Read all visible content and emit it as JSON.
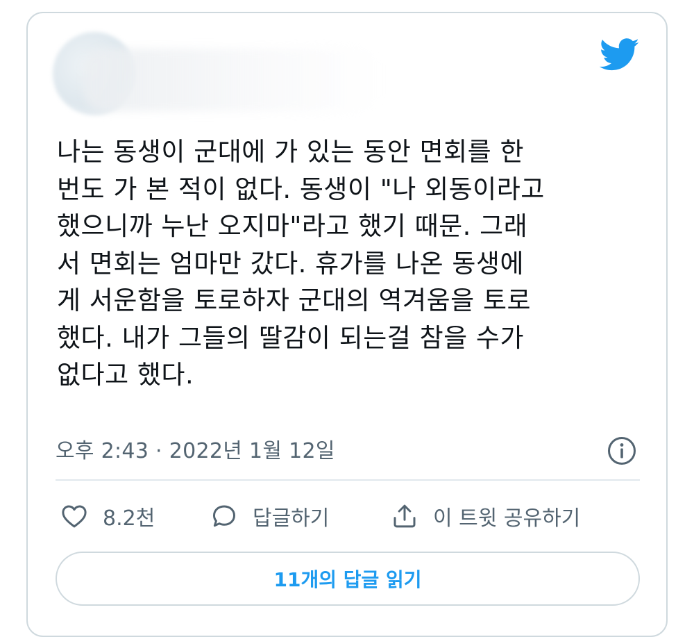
{
  "tweet": {
    "text": "나는 동생이 군대에 가 있는 동안 면회를 한\n번도 가 본 적이 없다. 동생이 \"나 외동이라고\n했으니까 누난 오지마\"라고 했기 때문. 그래\n서 면회는 엄마만 갔다. 휴가를 나온 동생에\n게 서운함을 토로하자 군대의 역겨움을 토로\n했다. 내가 그들의 딸감이 되는걸 참을 수가\n없다고 했다.",
    "timestamp": "오후 2:43 · 2022년 1월 12일"
  },
  "actions": {
    "like_count": "8.2천",
    "reply_label": "답글하기",
    "share_label": "이 트윗 공유하기"
  },
  "replies_button": "11개의 답글 읽기",
  "colors": {
    "brand": "#1d9bf0",
    "text": "#0f1419",
    "muted": "#536471",
    "border": "#cfd9de"
  },
  "icons": {
    "logo": "twitter-bird-icon",
    "info": "info-icon",
    "like": "heart-icon",
    "reply": "speech-bubble-icon",
    "share": "share-icon"
  }
}
